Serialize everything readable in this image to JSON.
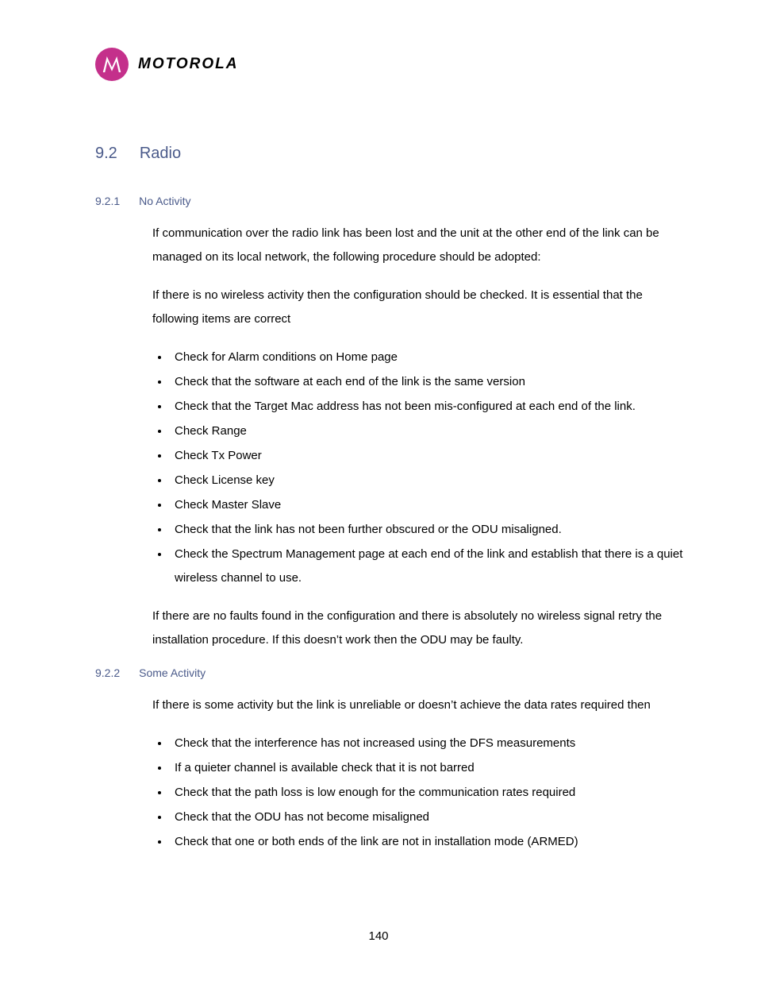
{
  "logo": {
    "brand": "MOTOROLA"
  },
  "section": {
    "number": "9.2",
    "title": "Radio"
  },
  "sub1": {
    "number": "9.2.1",
    "title": "No Activity",
    "para1": "If communication over the radio link has been lost and the unit at the other end of the link can be managed on its local network, the following procedure should be adopted:",
    "para2": "If there is no wireless activity then the configuration should be checked. It is essential that the following items are correct",
    "bullets": [
      "Check for Alarm conditions on Home page",
      "Check that the software at each end of the link is the same version",
      "Check that the Target Mac address has not been mis-configured at each end of the link.",
      "Check Range",
      "Check Tx Power",
      "Check License key",
      "Check Master Slave",
      "Check that the link has not been further obscured or the ODU misaligned.",
      "Check the Spectrum Management page at each end of the link and establish that there is a quiet wireless channel to use."
    ],
    "para3": "If there are no faults found in the configuration and there is absolutely no wireless signal retry the installation procedure. If this doesn’t work then the ODU may be faulty."
  },
  "sub2": {
    "number": "9.2.2",
    "title": "Some Activity",
    "para1": "If there is some activity but the link is unreliable or doesn’t achieve the data rates required then",
    "bullets": [
      "Check that the interference has not increased using the DFS measurements",
      "If a quieter channel is available check that it is not barred",
      "Check that the path loss is low enough for the communication rates required",
      "Check that the ODU has not become misaligned",
      "Check that one or both ends of the link are not in installation mode (ARMED)"
    ]
  },
  "page_number": "140"
}
